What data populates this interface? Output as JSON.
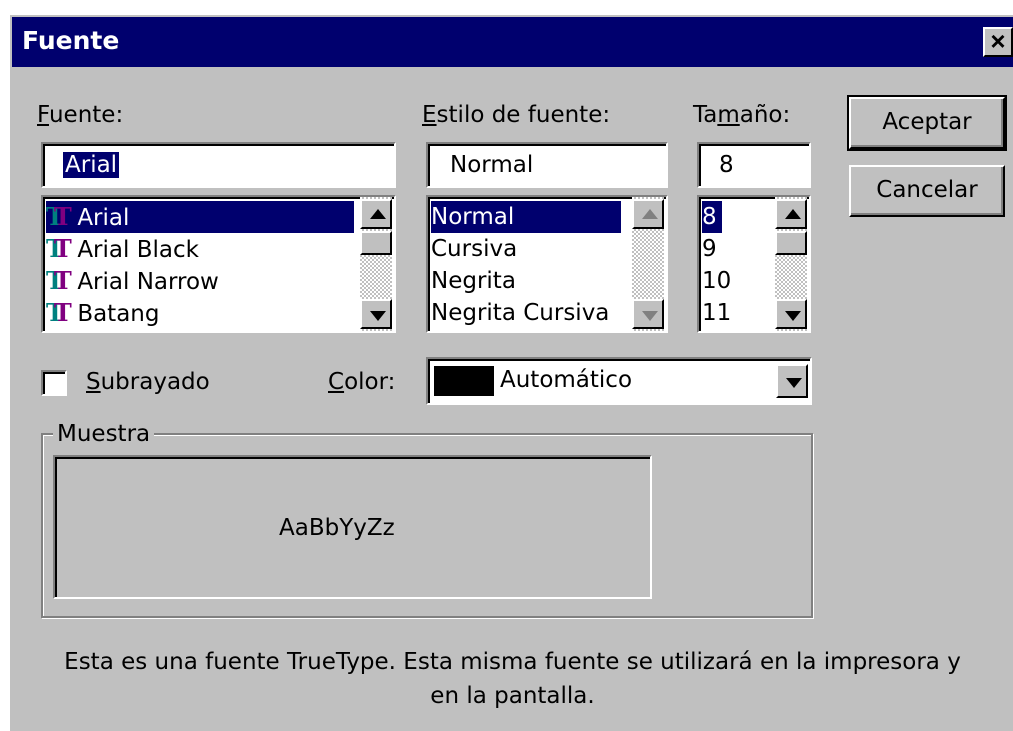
{
  "window": {
    "title": "Fuente",
    "close_glyph": "×"
  },
  "font": {
    "label_prefix": "",
    "label_underline": "F",
    "label_rest": "uente:",
    "value": "Arial",
    "items": [
      {
        "label": "Arial",
        "icon": "truetype-icon"
      },
      {
        "label": "Arial Black",
        "icon": "truetype-icon"
      },
      {
        "label": "Arial Narrow",
        "icon": "truetype-icon"
      },
      {
        "label": "Batang",
        "icon": "truetype-icon"
      }
    ]
  },
  "style": {
    "label_prefix": "",
    "label_underline": "E",
    "label_rest": "stilo de fuente:",
    "value": "Normal",
    "items": [
      "Normal",
      "Cursiva",
      "Negrita",
      "Negrita Cursiva"
    ]
  },
  "size": {
    "label_prefix": "Ta",
    "label_underline": "m",
    "label_rest": "año:",
    "value": "8",
    "items": [
      "8",
      "9",
      "10",
      "11"
    ]
  },
  "buttons": {
    "ok": "Aceptar",
    "cancel": "Cancelar"
  },
  "underline": {
    "label_underline": "S",
    "label_rest": "ubrayado",
    "checked": false
  },
  "color": {
    "label_underline": "C",
    "label_rest": "olor:",
    "value": "Automático",
    "swatch": "#000000"
  },
  "sample": {
    "group_label": "Muestra",
    "text": "AaBbYyZz"
  },
  "note": {
    "line1": "Esta es una fuente TrueType. Esta misma fuente se utilizará en la impresora y",
    "line2": "en la pantalla."
  },
  "colors": {
    "titlebar": "#00006e",
    "face": "#c0c0c0",
    "selection": "#00006e",
    "truetype_a": "#00807f",
    "truetype_b": "#800080"
  }
}
